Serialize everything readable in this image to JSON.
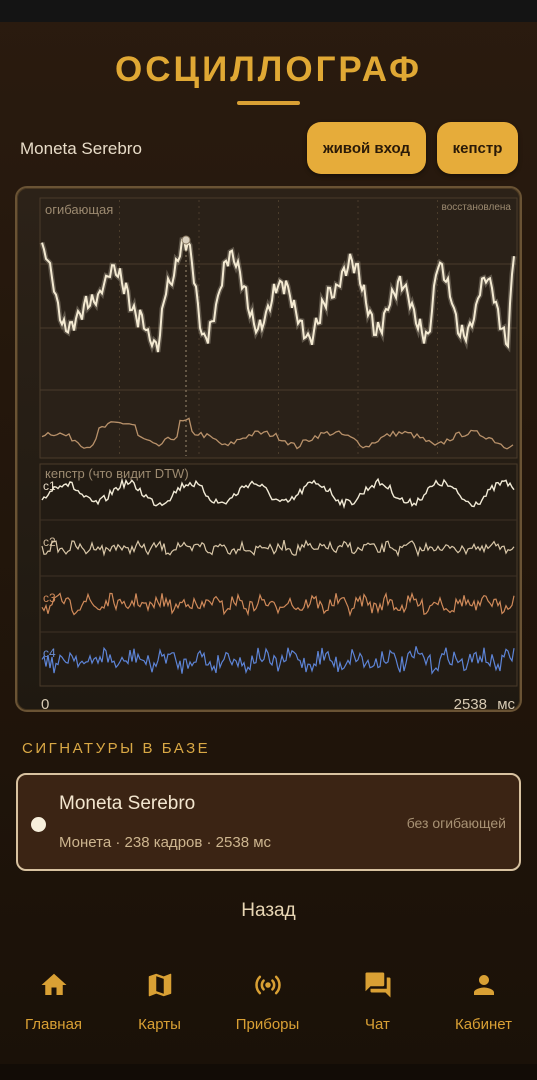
{
  "header": {
    "title": "ОСЦИЛЛОГРАФ"
  },
  "device": {
    "name": "Moneta Serebro"
  },
  "buttons": {
    "live_input": "живой вход",
    "cepstr": "кепстр"
  },
  "scope": {
    "envelope_label": "огибающая",
    "status_label": "восстановлена",
    "cepstr_label": "кепстр (что видит DTW)",
    "channels": [
      "c1",
      "c2",
      "c3",
      "c4"
    ],
    "axis_start": "0",
    "axis_end": "2538",
    "axis_unit": "мс",
    "colors": {
      "waveform": "#f4ead2",
      "envelope": "#b8916a",
      "c1": "#f1ead6",
      "c2": "#d9c7a8",
      "c3": "#d08a5a",
      "c4": "#5d84d6"
    }
  },
  "signatures": {
    "section_title": "СИГНАТУРЫ В БАЗЕ",
    "items": [
      {
        "name": "Moneta Serebro",
        "meta": "Монета · 238 кадров · 2538 мс",
        "status": "без огибающей"
      }
    ]
  },
  "back_label": "Назад",
  "nav": {
    "items": [
      {
        "label": "Главная",
        "icon": "home-icon"
      },
      {
        "label": "Карты",
        "icon": "map-icon"
      },
      {
        "label": "Приборы",
        "icon": "sensors-icon"
      },
      {
        "label": "Чат",
        "icon": "chat-icon"
      },
      {
        "label": "Кабинет",
        "icon": "person-icon"
      }
    ],
    "accent": "#d9a034"
  }
}
